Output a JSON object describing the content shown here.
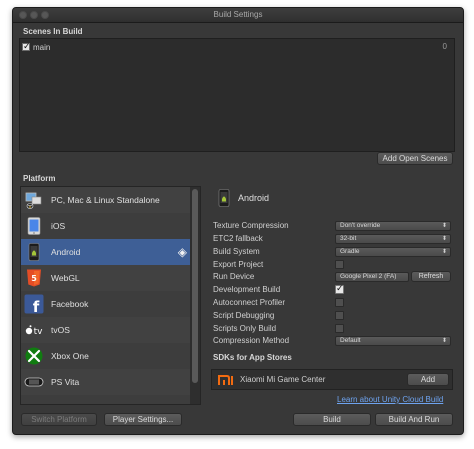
{
  "window": {
    "title": "Build Settings"
  },
  "scenes": {
    "header": "Scenes In Build",
    "items": [
      {
        "name": "main",
        "checked": true,
        "index": "0"
      }
    ],
    "add_button": "Add Open Scenes"
  },
  "platform": {
    "header": "Platform",
    "items": [
      {
        "name": "PC, Mac & Linux Standalone",
        "icon": "pc-mac-linux-icon"
      },
      {
        "name": "iOS",
        "icon": "ios-icon"
      },
      {
        "name": "Android",
        "icon": "android-icon",
        "selected": true,
        "active": true
      },
      {
        "name": "WebGL",
        "icon": "html5-icon"
      },
      {
        "name": "Facebook",
        "icon": "facebook-icon"
      },
      {
        "name": "tvOS",
        "icon": "appletv-icon"
      },
      {
        "name": "Xbox One",
        "icon": "xbox-icon"
      },
      {
        "name": "PS Vita",
        "icon": "psvita-icon"
      }
    ]
  },
  "settings": {
    "title": "Android",
    "texture_compression": {
      "label": "Texture Compression",
      "value": "Don't override"
    },
    "etc2_fallback": {
      "label": "ETC2 fallback",
      "value": "32-bit"
    },
    "build_system": {
      "label": "Build System",
      "value": "Gradle"
    },
    "export_project": {
      "label": "Export Project",
      "checked": false
    },
    "run_device": {
      "label": "Run Device",
      "value": "Google Pixel 2 (FA)",
      "refresh": "Refresh"
    },
    "development_build": {
      "label": "Development Build",
      "checked": true
    },
    "autoconnect_profiler": {
      "label": "Autoconnect Profiler",
      "checked": false
    },
    "script_debugging": {
      "label": "Script Debugging",
      "checked": false
    },
    "scripts_only_build": {
      "label": "Scripts Only Build",
      "checked": false
    },
    "compression_method": {
      "label": "Compression Method",
      "value": "Default"
    }
  },
  "sdks": {
    "header": "SDKs for App Stores",
    "items": [
      {
        "name": "Xiaomi Mi Game Center",
        "logo": "mi-logo",
        "button": "Add"
      }
    ]
  },
  "cloud_link": "Learn about Unity Cloud Build",
  "buttons": {
    "switch_platform": "Switch Platform",
    "player_settings": "Player Settings...",
    "build": "Build",
    "build_and_run": "Build And Run"
  },
  "colors": {
    "window_bg": "#383838",
    "selection": "#3e5f96",
    "link": "#6ea3ef",
    "mi_orange": "#f26b11"
  }
}
